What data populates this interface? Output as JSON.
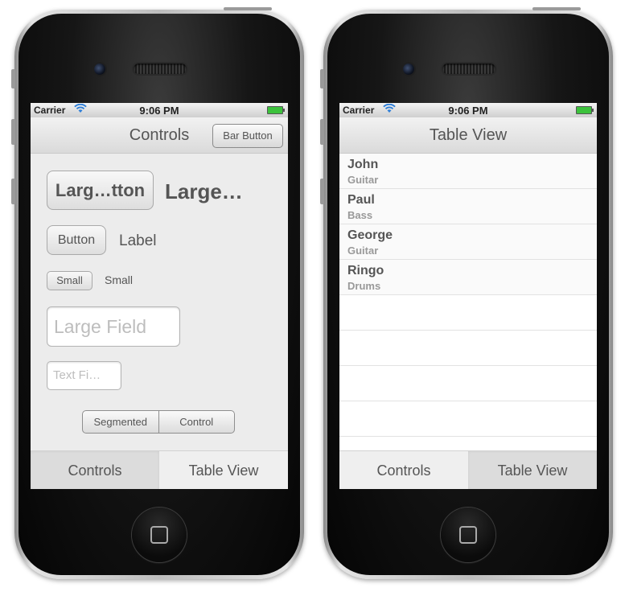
{
  "status_bar": {
    "carrier": "Carrier",
    "time": "9:06 PM"
  },
  "controls_screen": {
    "nav_title": "Controls",
    "bar_button": "Bar Button",
    "large_button": "Larg…tton",
    "large_label": "Large…",
    "button": "Button",
    "label": "Label",
    "small_button": "Small",
    "small_label": "Small",
    "large_field_placeholder": "Large Field",
    "text_field_placeholder": "Text Fi…",
    "segments": [
      "Segmented",
      "Control"
    ]
  },
  "table_screen": {
    "nav_title": "Table View",
    "rows": [
      {
        "title": "John",
        "detail": "Guitar"
      },
      {
        "title": "Paul",
        "detail": "Bass"
      },
      {
        "title": "George",
        "detail": "Guitar"
      },
      {
        "title": "Ringo",
        "detail": "Drums"
      }
    ]
  },
  "tab_bar": {
    "tabs": [
      "Controls",
      "Table View"
    ]
  },
  "colors": {
    "battery": "#3cc23c",
    "wifi": "#2f7fd8"
  },
  "icons": {
    "wifi": "wifi-icon",
    "battery": "battery-icon",
    "home": "home-button-icon"
  }
}
